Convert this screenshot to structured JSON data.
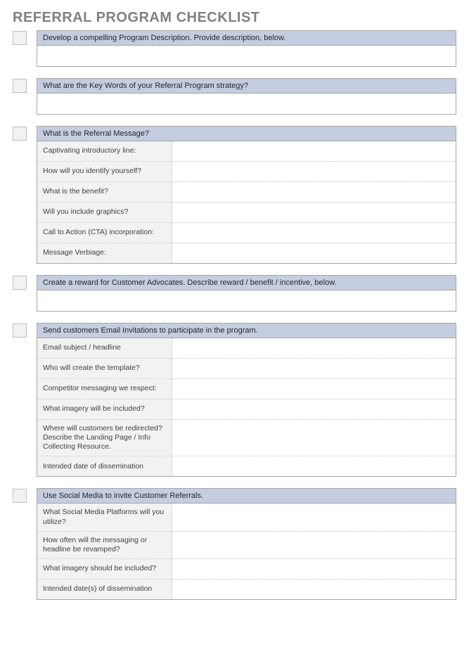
{
  "title": "REFERRAL PROGRAM CHECKLIST",
  "sections": [
    {
      "header": "Develop a compelling Program Description.  Provide description, below.",
      "type": "input"
    },
    {
      "header": "What are the Key Words of your Referral Program strategy?",
      "type": "input"
    },
    {
      "header": "What is the Referral Message?",
      "type": "details",
      "rows": [
        "Captivating introductory line:",
        "How will you identify yourself?",
        "What is the benefit?",
        "Will you include graphics?",
        "Call to Action (CTA) incorporation:",
        "Message Verbiage:"
      ]
    },
    {
      "header": "Create a reward for Customer Advocates.  Describe reward / benefit / incentive, below.",
      "type": "input"
    },
    {
      "header": "Send customers Email Invitations to participate in the program.",
      "type": "details",
      "rows": [
        "Email subject / headline",
        "Who will create the template?",
        "Competitor messaging we respect:",
        "What imagery will be included?",
        "Where will customers be redirected? Describe the Landing Page / Info Collecting Resource.",
        "Intended date of dissemination"
      ]
    },
    {
      "header": "Use Social Media to invite Customer Referrals.",
      "type": "details",
      "rows": [
        "What Social Media Platforms will you utilize?",
        "How often will the messaging or headline be revamped?",
        "What imagery should be included?",
        "Intended date(s) of dissemination"
      ]
    }
  ]
}
